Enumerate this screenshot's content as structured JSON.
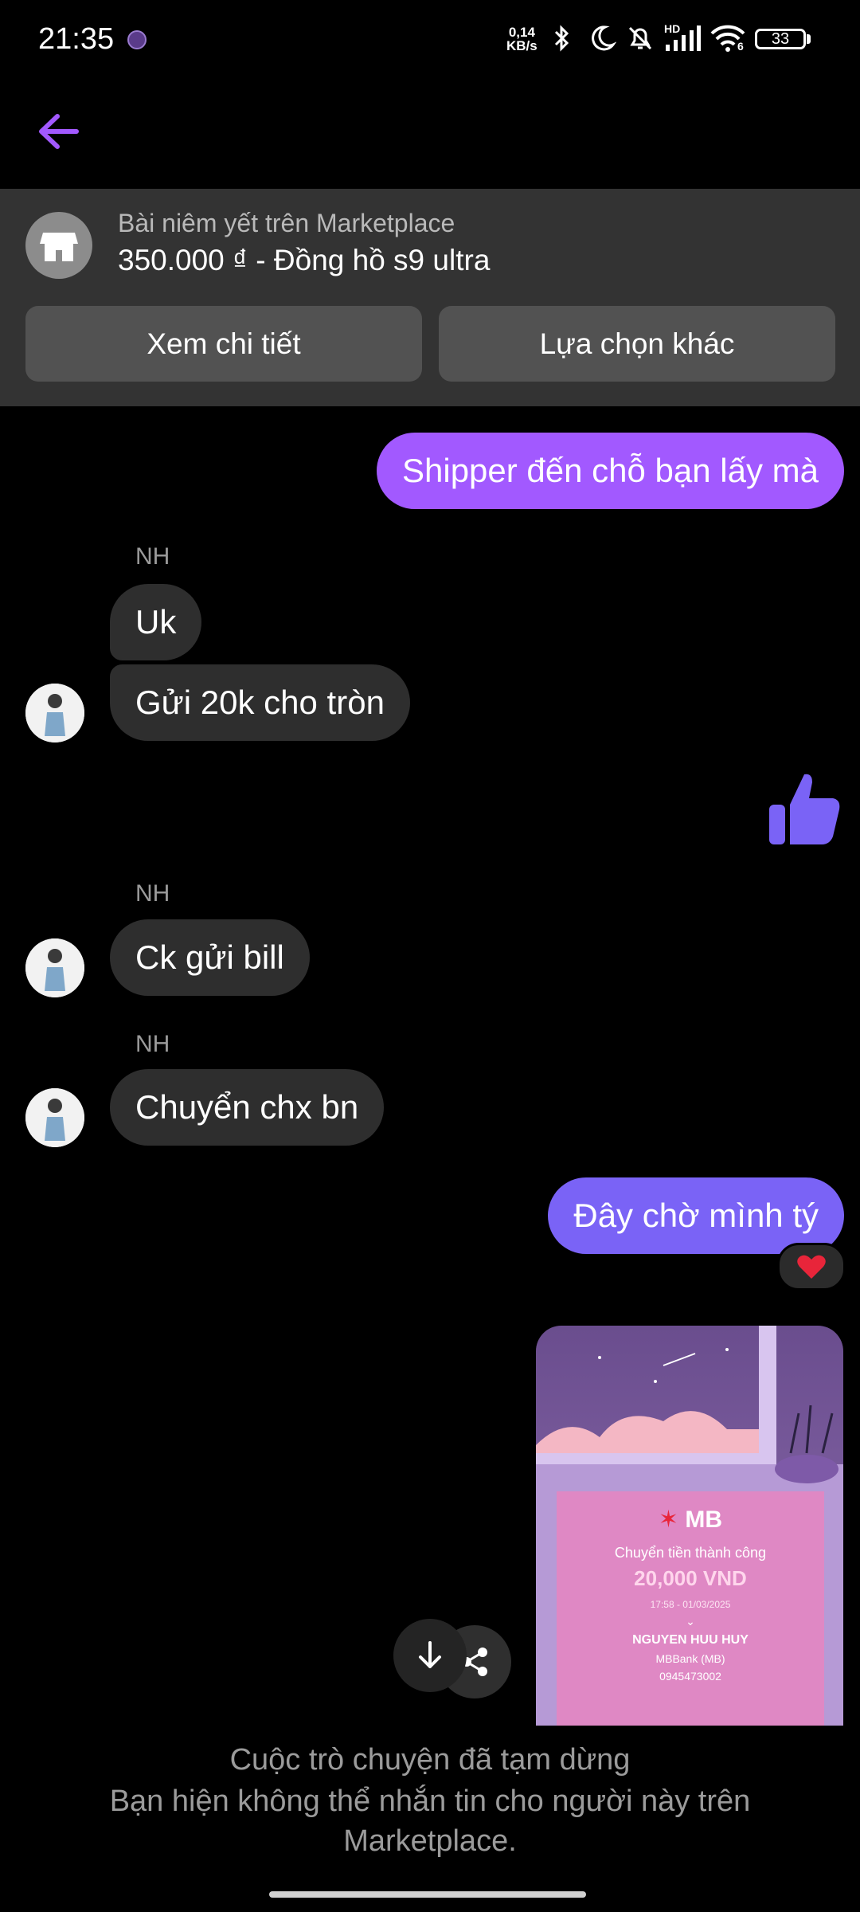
{
  "status_bar": {
    "time": "21:35",
    "network_speed_value": "0,14",
    "network_speed_unit": "KB/s",
    "signal_label": "HD",
    "wifi_label": "6",
    "battery": "33"
  },
  "listing": {
    "caption": "Bài niêm yết trên Marketplace",
    "title": "350.000 ₫ - Đồng hồ s9 ultra",
    "view_details_label": "Xem chi tiết",
    "other_options_label": "Lựa chọn khác"
  },
  "messages": {
    "m1": "Shipper đến chỗ bạn lấy mà",
    "sender_1": "NH",
    "m2": "Uk",
    "m3": "Gửi 20k cho tròn",
    "sender_2": "NH",
    "m4": "Ck gửi bill",
    "sender_3": "NH",
    "m5": "Chuyển chx bn",
    "m6": "Đây chờ mình tý"
  },
  "receipt": {
    "bank": "MB",
    "status": "Chuyển tiền thành công",
    "amount": "20,000 VND",
    "datetime": "17:58 - 01/03/2025",
    "recipient": "NGUYEN HUU HUY",
    "recipient_bank": "MBBank (MB)",
    "account": "0945473002"
  },
  "footer": {
    "title": "Cuộc trò chuyện đã tạm dừng",
    "description": "Bạn hiện không thể nhắn tin cho người này trên Marketplace."
  },
  "colors": {
    "accent_purple": "#a259ff",
    "accent_indigo": "#7a63f6",
    "incoming_bubble": "#2e2e2e",
    "banner_bg": "#333333"
  }
}
